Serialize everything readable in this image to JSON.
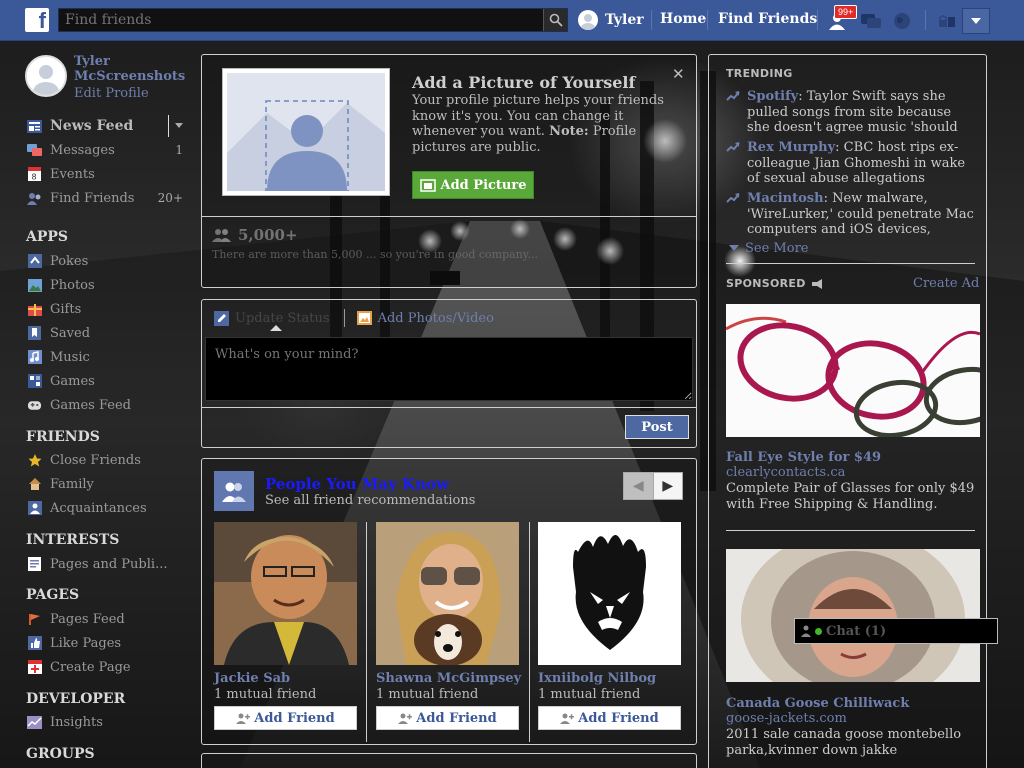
{
  "topbar": {
    "search_placeholder": "Find friends",
    "user_name": "Tyler",
    "home": "Home",
    "find_friends": "Find Friends",
    "notif_count": "99+",
    "brand_color": "#3b5998"
  },
  "profile": {
    "name": "Tyler McScreenshots",
    "edit": "Edit Profile"
  },
  "sidebar": {
    "main": [
      {
        "label": "News Feed",
        "icon": "news-feed-icon",
        "count": ""
      },
      {
        "label": "Messages",
        "icon": "messages-icon",
        "count": "1"
      },
      {
        "label": "Events",
        "icon": "events-icon",
        "count": ""
      },
      {
        "label": "Find Friends",
        "icon": "find-friends-icon",
        "count": "20+"
      }
    ],
    "apps_head": "APPS",
    "apps": [
      {
        "label": "Pokes",
        "icon": "pokes-icon"
      },
      {
        "label": "Photos",
        "icon": "photos-icon"
      },
      {
        "label": "Gifts",
        "icon": "gifts-icon"
      },
      {
        "label": "Saved",
        "icon": "saved-icon"
      },
      {
        "label": "Music",
        "icon": "music-icon"
      },
      {
        "label": "Games",
        "icon": "games-icon"
      },
      {
        "label": "Games Feed",
        "icon": "games-feed-icon"
      }
    ],
    "friends_head": "FRIENDS",
    "friends": [
      {
        "label": "Close Friends",
        "icon": "star-icon"
      },
      {
        "label": "Family",
        "icon": "family-icon"
      },
      {
        "label": "Acquaintances",
        "icon": "acquaintances-icon"
      }
    ],
    "interests_head": "INTERESTS",
    "interests": [
      {
        "label": "Pages and Publi...",
        "icon": "pages-public-icon"
      }
    ],
    "pages_head": "PAGES",
    "pages": [
      {
        "label": "Pages Feed",
        "icon": "pages-feed-icon"
      },
      {
        "label": "Like Pages",
        "icon": "like-icon"
      },
      {
        "label": "Create Page",
        "icon": "create-page-icon"
      }
    ],
    "developer_head": "DEVELOPER",
    "developer": [
      {
        "label": "Insights",
        "icon": "insights-icon"
      }
    ],
    "groups_head": "GROUPS"
  },
  "add_picture": {
    "title": "Add a Picture of Yourself",
    "desc_1": "Your profile picture helps your friends know it's you. You can change it whenever you want. ",
    "desc_note": "Note:",
    "desc_2": " Profile pictures are public.",
    "button": "Add Picture",
    "friends_count": "5,000+",
    "friends_note": "There are more than 5,000 ... so you're in good company..."
  },
  "composer": {
    "tab_status": "Update Status",
    "tab_photo": "Add Photos/Video",
    "placeholder": "What's on your mind?",
    "post": "Post"
  },
  "pymk": {
    "title": "People You May Know",
    "subtitle": "See all friend recommendations",
    "add_label": "Add Friend",
    "people": [
      {
        "name": "Jackie Sab",
        "mutual": "1 mutual friend"
      },
      {
        "name": "Shawna McGimpsey",
        "mutual": "1 mutual friend"
      },
      {
        "name": "Ixniibolg Nilbog",
        "mutual": "1 mutual friend"
      }
    ]
  },
  "trending": {
    "head": "TRENDING",
    "items": [
      {
        "topic": "Spotify",
        "text": ": Taylor Swift says she pulled songs from site because she doesn't agree music 'should"
      },
      {
        "topic": "Rex Murphy",
        "text": ": CBC host rips ex-colleague Jian Ghomeshi in wake of sexual abuse allegations"
      },
      {
        "topic": "Macintosh",
        "text": ": New malware, 'WireLurker,' could penetrate Mac computers and iOS devices,"
      }
    ],
    "see_more": "See More"
  },
  "sponsored": {
    "head": "SPONSORED",
    "create_ad": "Create Ad",
    "ads": [
      {
        "title": "Fall Eye Style for $49",
        "url": "clearlycontacts.ca",
        "desc": "Complete Pair of Glasses for only $49 with Free Shipping & Handling."
      },
      {
        "title": "Canada Goose Chilliwack",
        "url": "goose-jackets.com",
        "desc": "2011 sale canada goose montebello parka,kvinner down jakke"
      }
    ]
  },
  "chat": {
    "label": "Chat (1)"
  }
}
